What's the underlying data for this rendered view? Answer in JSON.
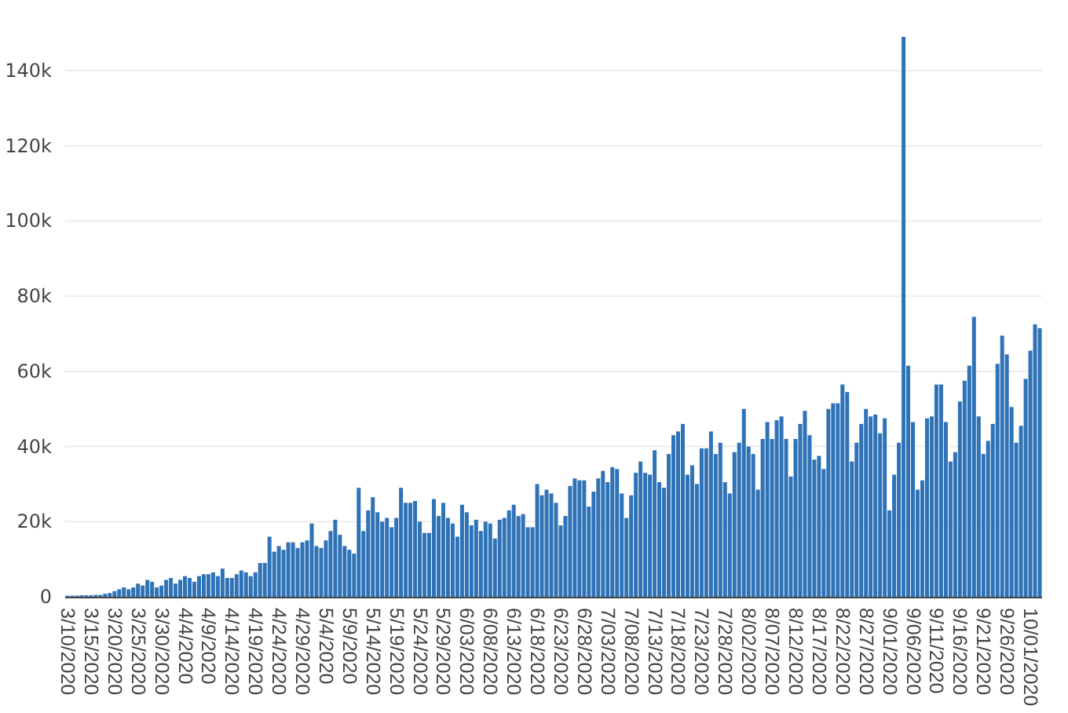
{
  "chart_data": {
    "type": "bar",
    "orientation": "vertical",
    "grid": true,
    "ylim": [
      0,
      149000
    ],
    "yticks": [
      {
        "value": 0,
        "label": "0"
      },
      {
        "value": 20000,
        "label": "20k"
      },
      {
        "value": 40000,
        "label": "40k"
      },
      {
        "value": 60000,
        "label": "60k"
      },
      {
        "value": 80000,
        "label": "80k"
      },
      {
        "value": 100000,
        "label": "100k"
      },
      {
        "value": 120000,
        "label": "120k"
      },
      {
        "value": 140000,
        "label": "140k"
      }
    ],
    "categories": [
      "3/10/2020",
      null,
      null,
      null,
      null,
      "3/15/2020",
      null,
      null,
      null,
      null,
      "3/20/2020",
      null,
      null,
      null,
      null,
      "3/25/2020",
      null,
      null,
      null,
      null,
      "3/30/2020",
      null,
      null,
      null,
      null,
      "4/4/2020",
      null,
      null,
      null,
      null,
      "4/9/2020",
      null,
      null,
      null,
      null,
      "4/14/2020",
      null,
      null,
      null,
      null,
      "4/19/2020",
      null,
      null,
      null,
      null,
      "4/24/2020",
      null,
      null,
      null,
      null,
      "4/29/2020",
      null,
      null,
      null,
      null,
      "5/4/2020",
      null,
      null,
      null,
      null,
      "5/9/2020",
      null,
      null,
      null,
      null,
      "5/14/2020",
      null,
      null,
      null,
      null,
      "5/19/2020",
      null,
      null,
      null,
      null,
      "5/24/2020",
      null,
      null,
      null,
      null,
      "5/29/2020",
      null,
      null,
      null,
      null,
      "6/03/2020",
      null,
      null,
      null,
      null,
      "6/08/2020",
      null,
      null,
      null,
      null,
      "6/13/2020",
      null,
      null,
      null,
      null,
      "6/18/2020",
      null,
      null,
      null,
      null,
      "6/23/2020",
      null,
      null,
      null,
      null,
      "6/28/2020",
      null,
      null,
      null,
      null,
      "7/03/2020",
      null,
      null,
      null,
      null,
      "7/08/2020",
      null,
      null,
      null,
      null,
      "7/13/2020",
      null,
      null,
      null,
      null,
      "7/18/2020",
      null,
      null,
      null,
      null,
      "7/23/2020",
      null,
      null,
      null,
      null,
      "7/28/2020",
      null,
      null,
      null,
      null,
      "8/02/2020",
      null,
      null,
      null,
      null,
      "8/07/2020",
      null,
      null,
      null,
      null,
      "8/12/2020",
      null,
      null,
      null,
      null,
      "8/17/2020",
      null,
      null,
      null,
      null,
      "8/22/2020",
      null,
      null,
      null,
      null,
      "8/27/2020",
      null,
      null,
      null,
      null,
      "9/01/2020",
      null,
      null,
      null,
      null,
      "9/06/2020",
      null,
      null,
      null,
      null,
      "9/11/2020",
      null,
      null,
      null,
      null,
      "9/16/2020",
      null,
      null,
      null,
      null,
      "9/21/2020",
      null,
      null,
      null,
      null,
      "9/26/2020",
      null,
      null,
      null,
      null,
      "10/01/2020",
      null,
      null
    ],
    "series": [
      {
        "color": "#2e73b7",
        "values": [
          300,
          300,
          300,
          400,
          400,
          400,
          500,
          500,
          800,
          1000,
          1500,
          2000,
          2500,
          2000,
          2500,
          3500,
          3000,
          4500,
          4000,
          2500,
          3000,
          4500,
          5000,
          3500,
          4500,
          5500,
          5000,
          4000,
          5500,
          6000,
          6000,
          6500,
          5500,
          7500,
          5000,
          5000,
          6000,
          7000,
          6500,
          5500,
          6500,
          9000,
          9000,
          16000,
          12000,
          13500,
          12500,
          14500,
          14500,
          13000,
          14500,
          15000,
          19500,
          13500,
          13000,
          15000,
          17500,
          20500,
          16500,
          13500,
          12500,
          11500,
          29000,
          17500,
          23000,
          26500,
          22500,
          20000,
          21000,
          18500,
          21000,
          29000,
          25000,
          25000,
          25500,
          20000,
          17000,
          17000,
          26000,
          21500,
          25000,
          21000,
          19500,
          16000,
          24500,
          22500,
          19000,
          20500,
          17500,
          20000,
          19500,
          15500,
          20500,
          21000,
          23000,
          24500,
          21500,
          22000,
          18500,
          18500,
          30000,
          27000,
          28500,
          27500,
          25000,
          19000,
          21500,
          29500,
          31500,
          31000,
          31000,
          24000,
          28000,
          31500,
          33500,
          30500,
          34500,
          34000,
          27500,
          21000,
          27000,
          33000,
          36000,
          33000,
          32500,
          39000,
          30500,
          29000,
          38000,
          43000,
          44000,
          46000,
          32500,
          35000,
          30000,
          39500,
          39500,
          44000,
          38000,
          41000,
          30500,
          27500,
          38500,
          41000,
          50000,
          40000,
          38000,
          28500,
          42000,
          46500,
          42000,
          47000,
          48000,
          42000,
          32000,
          42000,
          46000,
          49500,
          43000,
          36500,
          37500,
          34000,
          50000,
          51500,
          51500,
          56500,
          54500,
          36000,
          41000,
          46000,
          50000,
          48000,
          48500,
          43500,
          47500,
          23000,
          32500,
          41000,
          149000,
          61500,
          46500,
          28500,
          31000,
          47500,
          48000,
          56500,
          56500,
          46500,
          36000,
          38500,
          52000,
          57500,
          61500,
          74500,
          48000,
          38000,
          41500,
          46000,
          62000,
          69500,
          64500,
          50500,
          41000,
          45500,
          58000,
          65500,
          72500,
          71500
        ]
      }
    ]
  }
}
